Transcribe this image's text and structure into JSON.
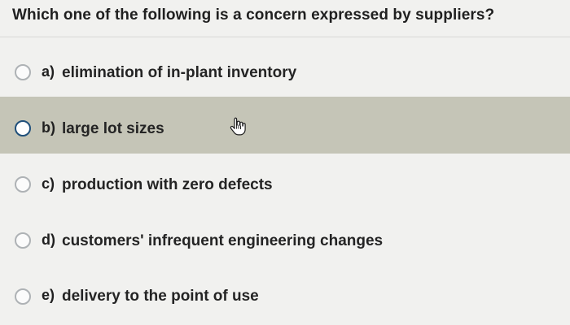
{
  "question": {
    "text": "Which one of the following is a concern expressed by suppliers?"
  },
  "options": [
    {
      "letter": "a)",
      "text": "elimination of in-plant inventory"
    },
    {
      "letter": "b)",
      "text": "large lot sizes"
    },
    {
      "letter": "c)",
      "text": "production with zero defects"
    },
    {
      "letter": "d)",
      "text": "customers' infrequent engineering changes"
    },
    {
      "letter": "e)",
      "text": "delivery to the point of use"
    }
  ],
  "icons": {
    "cursor": "hand-pointer-icon"
  },
  "colors": {
    "background": "#f1f1ef",
    "highlight": "#c5c5b7",
    "selected_radio_border": "#1f4f7a"
  }
}
